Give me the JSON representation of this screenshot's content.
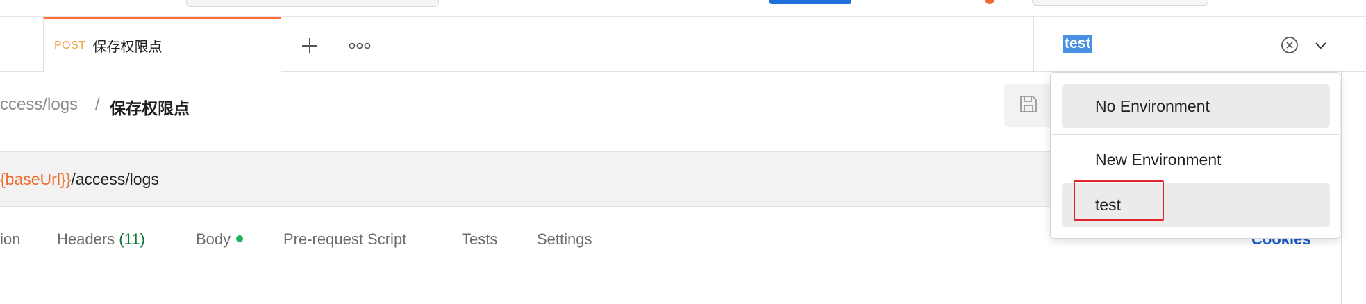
{
  "tab": {
    "method": "POST",
    "title": "保存权限点"
  },
  "tabbar": {
    "add_icon": "plus-icon",
    "more_icon": "more-horizontal-icon"
  },
  "environment": {
    "selected": "test",
    "clear_icon": "clear-circle-icon",
    "caret_icon": "chevron-down-icon"
  },
  "breadcrumb": {
    "parent": "ccess/logs",
    "separator": "/",
    "current": "保存权限点"
  },
  "toolbar": {
    "save_icon": "save-icon"
  },
  "url": {
    "variable": "{baseUrl}}",
    "path": "/access/logs"
  },
  "request_tabs": {
    "authorization": "ion",
    "headers": "Headers",
    "headers_count": "(11)",
    "body": "Body",
    "pre_request": "Pre-request Script",
    "tests": "Tests",
    "settings": "Settings",
    "cookies": "Cookies"
  },
  "dropdown": {
    "items": [
      {
        "label": "No Environment"
      },
      {
        "label": "New Environment"
      },
      {
        "label": "test"
      }
    ]
  },
  "colors": {
    "accent": "#ff6c37",
    "selection": "#4a90e2",
    "highlight_box": "#e0242c",
    "link": "#1a5fc7"
  }
}
